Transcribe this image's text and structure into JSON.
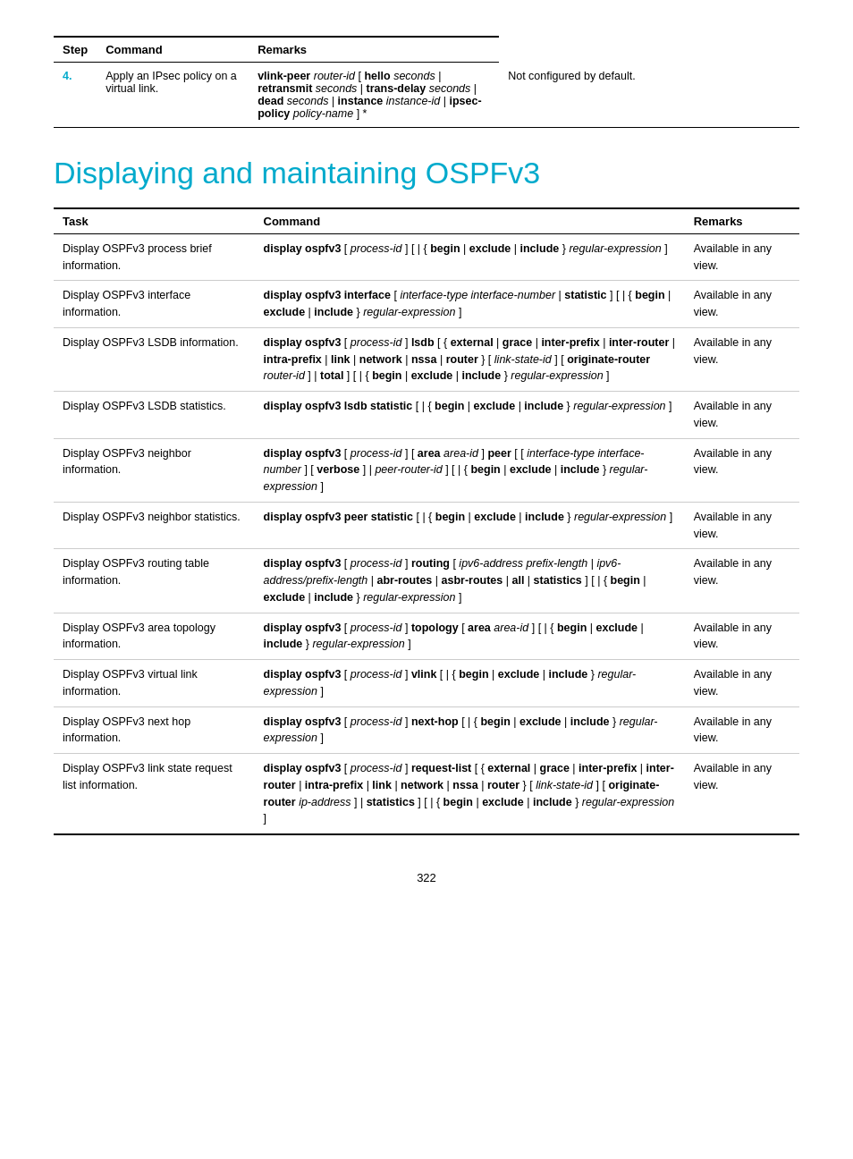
{
  "top_table": {
    "headers": [
      "Step",
      "Command",
      "Remarks"
    ],
    "rows": [
      {
        "step": "4.",
        "task": "Apply an IPsec policy on a virtual link.",
        "command_html": "<span class='bold'>vlink-peer</span> <span class='param'>router-id</span> [ <span class='bold'>hello</span> <span class='param'>seconds</span> | <span class='bold'>retransmit</span> <span class='param'>seconds</span> | <span class='bold'>trans-delay</span> <span class='param'>seconds</span> | <span class='bold'>dead</span> <span class='param'>seconds</span> | <span class='bold'>instance</span> <span class='param'>instance-id</span> | <span class='bold'>ipsec-policy</span> <span class='param'>policy-name</span> ] *",
        "remarks": "Not configured by default."
      }
    ]
  },
  "section_title": "Displaying and maintaining OSPFv3",
  "main_table": {
    "headers": [
      "Task",
      "Command",
      "Remarks"
    ],
    "rows": [
      {
        "task": "Display OSPFv3 process brief information.",
        "command_html": "<span class='bold'>display ospfv3</span> [ <span class='param'>process-id</span> ] [ | { <span class='bold'>begin</span> | <span class='bold'>exclude</span> | <span class='bold'>include</span> } <span class='param'>regular-expression</span> ]",
        "remarks": "Available in any view."
      },
      {
        "task": "Display OSPFv3 interface information.",
        "command_html": "<span class='bold'>display ospfv3 interface</span> [ <span class='param'>interface-type interface-number</span> | <span class='bold'>statistic</span> ] [ | { <span class='bold'>begin</span> | <span class='bold'>exclude</span> | <span class='bold'>include</span> } <span class='param'>regular-expression</span> ]",
        "remarks": "Available in any view."
      },
      {
        "task": "Display OSPFv3 LSDB information.",
        "command_html": "<span class='bold'>display ospfv3</span> [ <span class='param'>process-id</span> ] <span class='bold'>lsdb</span> [ { <span class='bold'>external</span> | <span class='bold'>grace</span> | <span class='bold'>inter-prefix</span> | <span class='bold'>inter-router</span> | <span class='bold'>intra-prefix</span> | <span class='bold'>link</span> | <span class='bold'>network</span> | <span class='bold'>nssa</span> | <span class='bold'>router</span> } [ <span class='param'>link-state-id</span> ] [ <span class='bold'>originate-router</span> <span class='param'>router-id</span> ] | <span class='bold'>total</span> ] [ | { <span class='bold'>begin</span> | <span class='bold'>exclude</span> | <span class='bold'>include</span> } <span class='param'>regular-expression</span> ]",
        "remarks": "Available in any view."
      },
      {
        "task": "Display OSPFv3 LSDB statistics.",
        "command_html": "<span class='bold'>display ospfv3 lsdb statistic</span> [ | { <span class='bold'>begin</span> | <span class='bold'>exclude</span> | <span class='bold'>include</span> } <span class='param'>regular-expression</span> ]",
        "remarks": "Available in any view."
      },
      {
        "task": "Display OSPFv3 neighbor information.",
        "command_html": "<span class='bold'>display ospfv3</span> [ <span class='param'>process-id</span> ] [ <span class='bold'>area</span> <span class='param'>area-id</span> ] <span class='bold'>peer</span> [ [ <span class='param'>interface-type interface-number</span> ] [ <span class='bold'>verbose</span> ] | <span class='param'>peer-router-id</span> ] [ | { <span class='bold'>begin</span> | <span class='bold'>exclude</span> | <span class='bold'>include</span> } <span class='param'>regular-expression</span> ]",
        "remarks": "Available in any view."
      },
      {
        "task": "Display OSPFv3 neighbor statistics.",
        "command_html": "<span class='bold'>display ospfv3 peer statistic</span> [ | { <span class='bold'>begin</span> | <span class='bold'>exclude</span> | <span class='bold'>include</span> } <span class='param'>regular-expression</span> ]",
        "remarks": "Available in any view."
      },
      {
        "task": "Display OSPFv3 routing table information.",
        "command_html": "<span class='bold'>display ospfv3</span> [ <span class='param'>process-id</span> ] <span class='bold'>routing</span> [ <span class='param'>ipv6-address prefix-length</span> | <span class='param'>ipv6-address/prefix-length</span> | <span class='bold'>abr-routes</span> | <span class='bold'>asbr-routes</span> | <span class='bold'>all</span> | <span class='bold'>statistics</span> ] [ | { <span class='bold'>begin</span> | <span class='bold'>exclude</span> | <span class='bold'>include</span> } <span class='param'>regular-expression</span> ]",
        "remarks": "Available in any view."
      },
      {
        "task": "Display OSPFv3 area topology information.",
        "command_html": "<span class='bold'>display ospfv3</span> [ <span class='param'>process-id</span> ] <span class='bold'>topology</span> [ <span class='bold'>area</span> <span class='param'>area-id</span> ] [ | { <span class='bold'>begin</span> | <span class='bold'>exclude</span> | <span class='bold'>include</span> } <span class='param'>regular-expression</span> ]",
        "remarks": "Available in any view."
      },
      {
        "task": "Display OSPFv3 virtual link information.",
        "command_html": "<span class='bold'>display ospfv3</span> [ <span class='param'>process-id</span> ] <span class='bold'>vlink</span> [ | { <span class='bold'>begin</span> | <span class='bold'>exclude</span> | <span class='bold'>include</span> } <span class='param'>regular-expression</span> ]",
        "remarks": "Available in any view."
      },
      {
        "task": "Display OSPFv3 next hop information.",
        "command_html": "<span class='bold'>display ospfv3</span> [ <span class='param'>process-id</span> ] <span class='bold'>next-hop</span> [ | { <span class='bold'>begin</span> | <span class='bold'>exclude</span> | <span class='bold'>include</span> } <span class='param'>regular-expression</span> ]",
        "remarks": "Available in any view."
      },
      {
        "task": "Display OSPFv3 link state request list information.",
        "command_html": "<span class='bold'>display ospfv3</span> [ <span class='param'>process-id</span> ] <span class='bold'>request-list</span> [ { <span class='bold'>external</span> | <span class='bold'>grace</span> | <span class='bold'>inter-prefix</span> | <span class='bold'>inter-router</span> | <span class='bold'>intra-prefix</span> | <span class='bold'>link</span> | <span class='bold'>network</span> | <span class='bold'>nssa</span> | <span class='bold'>router</span> } [ <span class='param'>link-state-id</span> ] [ <span class='bold'>originate-router</span> <span class='param'>ip-address</span> ] | <span class='bold'>statistics</span> ] [ | { <span class='bold'>begin</span> | <span class='bold'>exclude</span> | <span class='bold'>include</span> } <span class='param'>regular-expression</span> ]",
        "remarks": "Available in any view."
      }
    ]
  },
  "page_number": "322"
}
